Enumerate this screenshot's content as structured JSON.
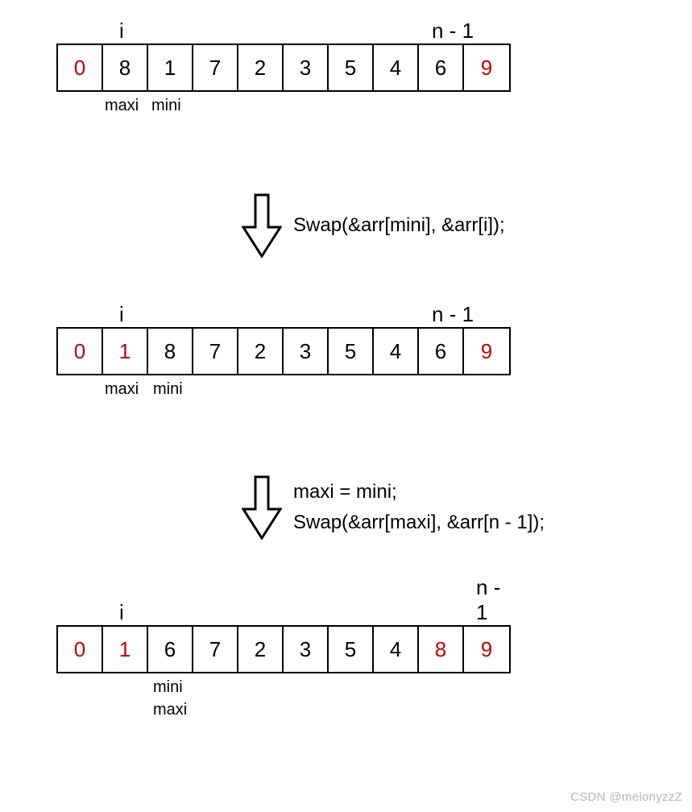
{
  "labels": {
    "i": "i",
    "n_minus_1": "n - 1",
    "maxi": "maxi",
    "mini": "mini"
  },
  "steps": {
    "step1_code": "Swap(&arr[mini], &arr[i]);",
    "step2_code_line1": "maxi = mini;",
    "step2_code_line2": "Swap(&arr[maxi], &arr[n - 1]);"
  },
  "arrays": {
    "a1": [
      "0",
      "8",
      "1",
      "7",
      "2",
      "3",
      "5",
      "4",
      "6",
      "9"
    ],
    "a2": [
      "0",
      "1",
      "8",
      "7",
      "2",
      "3",
      "5",
      "4",
      "6",
      "9"
    ],
    "a3": [
      "0",
      "1",
      "6",
      "7",
      "2",
      "3",
      "5",
      "4",
      "8",
      "9"
    ]
  },
  "highlights": {
    "a1": [
      0,
      9
    ],
    "a2": [
      0,
      1,
      9
    ],
    "a3": [
      0,
      1,
      8,
      9
    ]
  },
  "chart_data": {
    "type": "table",
    "description": "Selection-sort style diagram showing three array states with maxi/mini pointer labels and swap operations between them.",
    "states": [
      {
        "array": [
          0,
          8,
          1,
          7,
          2,
          3,
          5,
          4,
          6,
          9
        ],
        "i_index": 1,
        "n_minus_1_index": 8,
        "maxi_index": 1,
        "mini_index": 2,
        "highlighted_indices": [
          0,
          9
        ]
      },
      {
        "array": [
          0,
          1,
          8,
          7,
          2,
          3,
          5,
          4,
          6,
          9
        ],
        "i_index": 1,
        "n_minus_1_index": 8,
        "maxi_index": 1,
        "mini_index": 2,
        "highlighted_indices": [
          0,
          1,
          9
        ]
      },
      {
        "array": [
          0,
          1,
          6,
          7,
          2,
          3,
          5,
          4,
          8,
          9
        ],
        "i_index": 1,
        "n_minus_1_index": 8,
        "mini_index": 2,
        "maxi_index": 2,
        "highlighted_indices": [
          0,
          1,
          8,
          9
        ]
      }
    ],
    "transitions": [
      {
        "from": 0,
        "to": 1,
        "op": "Swap(&arr[mini], &arr[i]);"
      },
      {
        "from": 1,
        "to": 2,
        "op": "maxi = mini; Swap(&arr[maxi], &arr[n - 1]);"
      }
    ]
  },
  "watermark": "CSDN @melonyzzZ"
}
